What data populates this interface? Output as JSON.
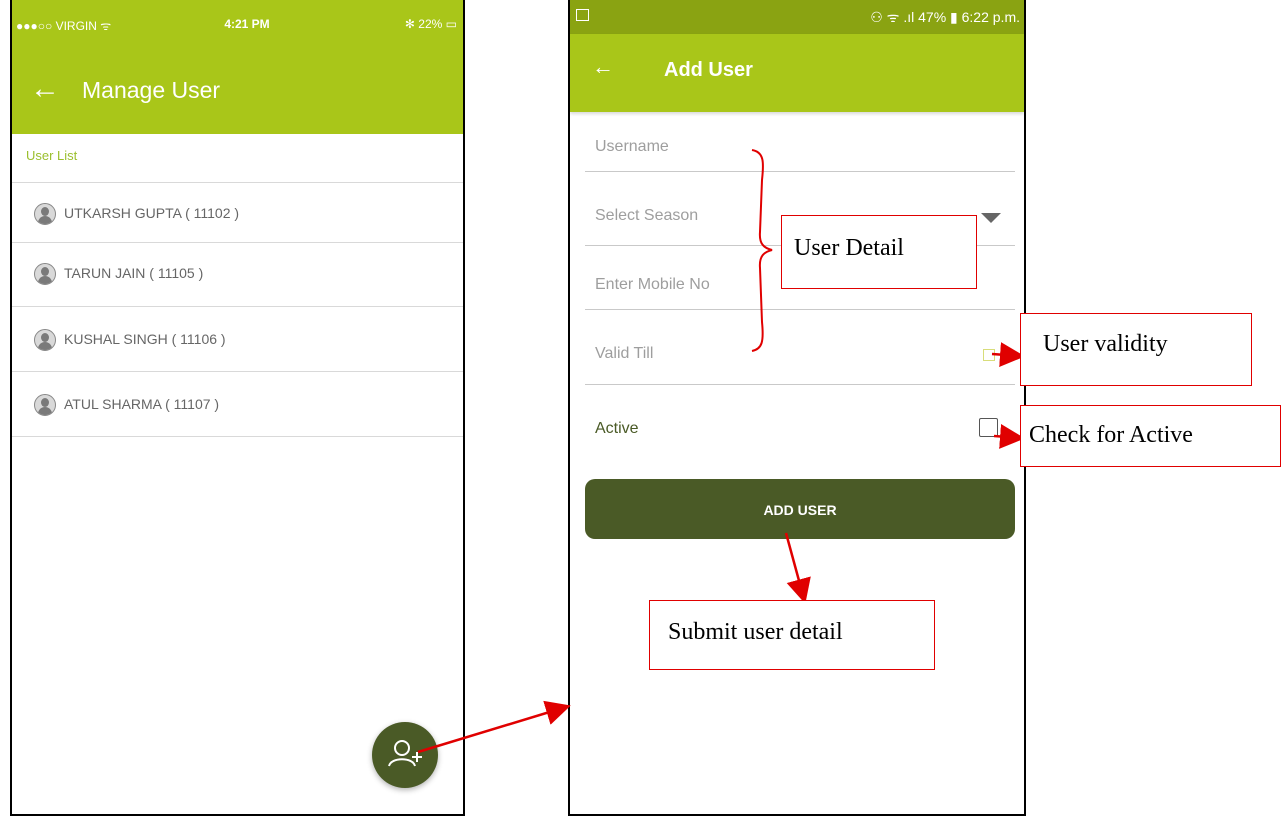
{
  "left_phone": {
    "status": {
      "carrier": "●●●○○ VIRGIN ᯤ",
      "time": "4:21 PM",
      "battery": "✻ 22% ▭"
    },
    "header": {
      "back_icon": "left-arrow-icon",
      "title": "Manage User"
    },
    "section_title": "User List",
    "users": [
      {
        "name": "UTKARSH  GUPTA ( 11102 )"
      },
      {
        "name": "TARUN JAIN ( 11105 )"
      },
      {
        "name": "KUSHAL SINGH ( 11106 )"
      },
      {
        "name": "ATUL SHARMA ( 11107 )"
      }
    ],
    "fab_icon": "add-user-icon"
  },
  "right_phone": {
    "status": {
      "right": "⚇ ᯤ .ıl 47% ▮ 6:22 p.m."
    },
    "header": {
      "back_icon": "left-arrow-icon",
      "title": "Add User"
    },
    "fields": {
      "username": "Username",
      "season": "Select Season",
      "mobile": "Enter Mobile No",
      "valid_till": "Valid Till"
    },
    "active_label": "Active",
    "add_button": "ADD USER"
  },
  "annotations": {
    "user_detail": "User Detail",
    "user_validity": "User validity",
    "check_active": "Check for Active",
    "submit": "Submit user detail"
  },
  "colors": {
    "app_bar": "#a9c619",
    "status_bar": "#8aa312",
    "primary_dark": "#4a5a26",
    "annotation_red": "#e00000"
  }
}
